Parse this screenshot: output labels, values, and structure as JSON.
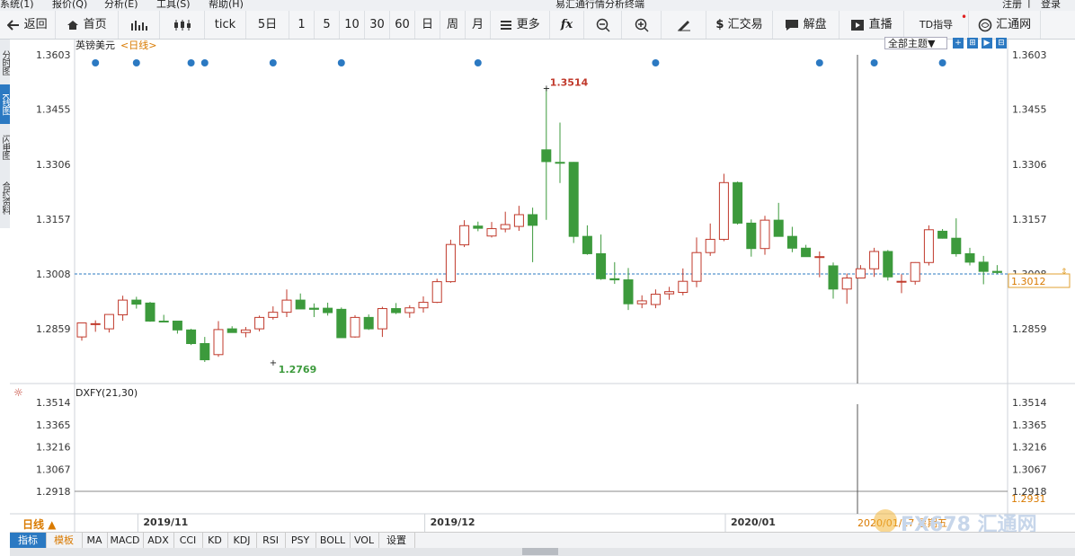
{
  "menu": [
    "系统(1)",
    "报价(Q)",
    "分析(E)",
    "工具(S)",
    "帮助(H)"
  ],
  "app_title": "易汇通行情分析终端",
  "account": [
    "注册",
    "|",
    "登录"
  ],
  "toolbar": {
    "back": "返回",
    "home": "首页",
    "tick": "tick",
    "periods": [
      "5日",
      "1",
      "5",
      "10",
      "30",
      "60",
      "日",
      "周",
      "月"
    ],
    "more": "更多",
    "fx": "fx",
    "forex_trade": "汇交易",
    "analysis": "解盘",
    "live": "直播",
    "td_guide": "TD指导",
    "fx678": "汇通网"
  },
  "side_tabs": [
    "分时图",
    "K线图",
    "闪电图",
    "合约资料"
  ],
  "symbol": "英镑美元",
  "period_link": "<日线>",
  "theme_select": "全部主题▼",
  "top_icons": [
    "+",
    "⊞",
    "▶",
    "⊟"
  ],
  "indicator_name": "DXFY(21,30)",
  "bottom_left_label": "日线 ▲",
  "crosshair_label": "2020/01/17 星期五",
  "price_tag": "1.3012",
  "dxfy_tag": "1.2931",
  "bottom_tabs": [
    "指标",
    "模板",
    "MA",
    "MACD",
    "ADX",
    "CCI",
    "KD",
    "KDJ",
    "RSI",
    "PSY",
    "BOLL",
    "VOL",
    "设置"
  ],
  "watermark": "FX678 汇通网",
  "colors": {
    "up": "#c0392b",
    "down": "#3c9a3c",
    "accent": "#2b79c2",
    "grid": "#e5e5e5"
  },
  "chart_data": {
    "type": "candlestick",
    "series_name": "英镑美元",
    "ylim": [
      1.2769,
      1.3603
    ],
    "y_ticks": [
      1.3603,
      1.3455,
      1.3306,
      1.3157,
      1.3008,
      1.2859
    ],
    "x_labels": [
      {
        "label": "2019/11",
        "index": 4.5
      },
      {
        "label": "2019/12",
        "index": 25.5
      },
      {
        "label": "2020/01",
        "index": 47.5
      }
    ],
    "max_label": {
      "value": "1.3514",
      "index": 34
    },
    "min_label": {
      "value": "1.2769",
      "index": 14
    },
    "current_price": 1.3008,
    "event_dots_index": [
      1,
      4,
      8,
      9,
      14,
      19,
      29,
      42,
      54,
      58,
      63
    ],
    "ohlc": [
      [
        1.2837,
        1.2875,
        1.2827,
        1.2875
      ],
      [
        1.2872,
        1.2882,
        1.2851,
        1.2873
      ],
      [
        1.2859,
        1.2898,
        1.2849,
        1.2898
      ],
      [
        1.2897,
        1.2949,
        1.2881,
        1.2937
      ],
      [
        1.2937,
        1.2946,
        1.2914,
        1.2926
      ],
      [
        1.2929,
        1.2932,
        1.2878,
        1.288
      ],
      [
        1.288,
        1.2897,
        1.2878,
        1.2879
      ],
      [
        1.288,
        1.288,
        1.2846,
        1.2856
      ],
      [
        1.2856,
        1.2859,
        1.2815,
        1.2819
      ],
      [
        1.2819,
        1.2837,
        1.2769,
        1.2775
      ],
      [
        1.2789,
        1.288,
        1.2783,
        1.2857
      ],
      [
        1.2859,
        1.2866,
        1.2849,
        1.2849
      ],
      [
        1.2849,
        1.2864,
        1.2836,
        1.2856
      ],
      [
        1.2859,
        1.2895,
        1.2852,
        1.289
      ],
      [
        1.289,
        1.292,
        1.2884,
        1.2904
      ],
      [
        1.2904,
        1.2966,
        1.2891,
        1.2937
      ],
      [
        1.2937,
        1.2955,
        1.2917,
        1.2913
      ],
      [
        1.2915,
        1.2928,
        1.2891,
        1.2912
      ],
      [
        1.2915,
        1.293,
        1.2895,
        1.2903
      ],
      [
        1.2912,
        1.2917,
        1.2839,
        1.2835
      ],
      [
        1.2837,
        1.2896,
        1.2835,
        1.289
      ],
      [
        1.289,
        1.2898,
        1.2856,
        1.2859
      ],
      [
        1.2859,
        1.2919,
        1.2837,
        1.2914
      ],
      [
        1.2914,
        1.2929,
        1.2899,
        1.2903
      ],
      [
        1.2903,
        1.2923,
        1.2889,
        1.2916
      ],
      [
        1.2916,
        1.2947,
        1.2903,
        1.2931
      ],
      [
        1.2931,
        1.2995,
        1.2929,
        1.2987
      ],
      [
        1.2987,
        1.3101,
        1.2984,
        1.3088
      ],
      [
        1.3087,
        1.3154,
        1.3081,
        1.3139
      ],
      [
        1.3138,
        1.315,
        1.3124,
        1.3132
      ],
      [
        1.3111,
        1.3149,
        1.3107,
        1.3131
      ],
      [
        1.313,
        1.3177,
        1.3121,
        1.3142
      ],
      [
        1.3137,
        1.3193,
        1.3125,
        1.3169
      ],
      [
        1.3169,
        1.3188,
        1.304,
        1.314
      ],
      [
        1.3345,
        1.3514,
        1.3155,
        1.3313
      ],
      [
        1.3311,
        1.3419,
        1.3255,
        1.331
      ],
      [
        1.3311,
        1.3312,
        1.3092,
        1.311
      ],
      [
        1.311,
        1.314,
        1.306,
        1.3063
      ],
      [
        1.3063,
        1.3115,
        1.2992,
        1.2995
      ],
      [
        1.2995,
        1.304,
        1.2981,
        1.2992
      ],
      [
        1.2992,
        1.3024,
        1.291,
        1.2927
      ],
      [
        1.2927,
        1.295,
        1.2915,
        1.2935
      ],
      [
        1.2925,
        1.2966,
        1.2915,
        1.2953
      ],
      [
        1.2954,
        1.2973,
        1.2938,
        1.296
      ],
      [
        1.2958,
        1.3023,
        1.295,
        1.2988
      ],
      [
        1.2988,
        1.3107,
        1.2972,
        1.3066
      ],
      [
        1.3066,
        1.3145,
        1.3057,
        1.3102
      ],
      [
        1.3102,
        1.328,
        1.3097,
        1.3256
      ],
      [
        1.3256,
        1.3259,
        1.3142,
        1.3146
      ],
      [
        1.3146,
        1.3156,
        1.3055,
        1.3077
      ],
      [
        1.3077,
        1.3166,
        1.306,
        1.3154
      ],
      [
        1.3154,
        1.3201,
        1.311,
        1.311
      ],
      [
        1.311,
        1.3136,
        1.3067,
        1.3078
      ],
      [
        1.3078,
        1.3087,
        1.3058,
        1.3055
      ],
      [
        1.3055,
        1.3069,
        1.2999,
        1.3055
      ],
      [
        1.303,
        1.3039,
        1.2941,
        1.2967
      ],
      [
        1.2967,
        1.3009,
        1.2927,
        1.2997
      ],
      [
        1.2997,
        1.3032,
        1.2997,
        1.3022
      ],
      [
        1.3022,
        1.3079,
        1.3,
        1.3069
      ],
      [
        1.3069,
        1.3073,
        1.299,
        1.3
      ],
      [
        1.2987,
        1.3007,
        1.2956,
        1.2988
      ],
      [
        1.2988,
        1.304,
        1.2979,
        1.3039
      ],
      [
        1.3039,
        1.314,
        1.3031,
        1.3128
      ],
      [
        1.3124,
        1.313,
        1.3104,
        1.3105
      ],
      [
        1.3105,
        1.3159,
        1.3055,
        1.3063
      ],
      [
        1.3063,
        1.3079,
        1.3031,
        1.304
      ],
      [
        1.304,
        1.3057,
        1.298,
        1.3015
      ],
      [
        1.3015,
        1.3032,
        1.3008,
        1.3012
      ]
    ],
    "indicator": {
      "name": "DXFY(21,30)",
      "ylim": [
        1.2918,
        1.3514
      ],
      "y_ticks": [
        1.3514,
        1.3365,
        1.3216,
        1.3067,
        1.2918
      ],
      "last_value": 1.2931
    }
  }
}
